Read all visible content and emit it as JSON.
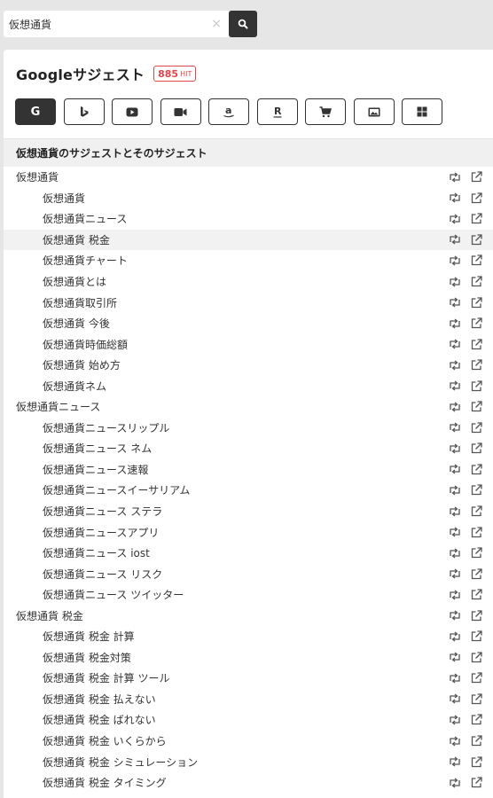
{
  "search": {
    "value": "仮想通貨",
    "clear_label": "×"
  },
  "card": {
    "title": "Googleサジェスト",
    "hit_count": "885",
    "hit_unit": "HIT",
    "engines": [
      {
        "name": "google",
        "icon": "google-g-icon",
        "active": true
      },
      {
        "name": "bing",
        "icon": "bing-icon"
      },
      {
        "name": "youtube",
        "icon": "youtube-play-icon"
      },
      {
        "name": "video",
        "icon": "video-camera-icon"
      },
      {
        "name": "amazon",
        "icon": "amazon-a-icon"
      },
      {
        "name": "rakuten",
        "icon": "rakuten-r-icon"
      },
      {
        "name": "shopping",
        "icon": "shopping-cart-icon"
      },
      {
        "name": "image",
        "icon": "image-icon"
      },
      {
        "name": "apps",
        "icon": "grid-icon"
      }
    ],
    "section_title": "仮想通貨のサジェストとそのサジェスト"
  },
  "rows": [
    {
      "text": "仮想通貨",
      "level": "parent"
    },
    {
      "text": "仮想通貨",
      "level": "child"
    },
    {
      "text": "仮想通貨ニュース",
      "level": "child"
    },
    {
      "text": "仮想通貨 税金",
      "level": "child",
      "highlight": true
    },
    {
      "text": "仮想通貨チャート",
      "level": "child"
    },
    {
      "text": "仮想通貨とは",
      "level": "child"
    },
    {
      "text": "仮想通貨取引所",
      "level": "child"
    },
    {
      "text": "仮想通貨 今後",
      "level": "child"
    },
    {
      "text": "仮想通貨時価総額",
      "level": "child"
    },
    {
      "text": "仮想通貨 始め方",
      "level": "child"
    },
    {
      "text": "仮想通貨ネム",
      "level": "child"
    },
    {
      "text": "仮想通貨ニュース",
      "level": "parent"
    },
    {
      "text": "仮想通貨ニュースリップル",
      "level": "child"
    },
    {
      "text": "仮想通貨ニュース ネム",
      "level": "child"
    },
    {
      "text": "仮想通貨ニュース速報",
      "level": "child"
    },
    {
      "text": "仮想通貨ニュースイーサリアム",
      "level": "child"
    },
    {
      "text": "仮想通貨ニュース ステラ",
      "level": "child"
    },
    {
      "text": "仮想通貨ニュースアプリ",
      "level": "child"
    },
    {
      "text": "仮想通貨ニュース iost",
      "level": "child"
    },
    {
      "text": "仮想通貨ニュース リスク",
      "level": "child"
    },
    {
      "text": "仮想通貨ニュース ツイッター",
      "level": "child"
    },
    {
      "text": "仮想通貨 税金",
      "level": "parent"
    },
    {
      "text": "仮想通貨 税金 計算",
      "level": "child"
    },
    {
      "text": "仮想通貨 税金対策",
      "level": "child"
    },
    {
      "text": "仮想通貨 税金 計算 ツール",
      "level": "child"
    },
    {
      "text": "仮想通貨 税金 払えない",
      "level": "child"
    },
    {
      "text": "仮想通貨 税金 ばれない",
      "level": "child"
    },
    {
      "text": "仮想通貨 税金 いくらから",
      "level": "child"
    },
    {
      "text": "仮想通貨 税金 シミュレーション",
      "level": "child"
    },
    {
      "text": "仮想通貨 税金 タイミング",
      "level": "child"
    }
  ],
  "row_actions": [
    "retweet-icon",
    "external-link-icon"
  ]
}
